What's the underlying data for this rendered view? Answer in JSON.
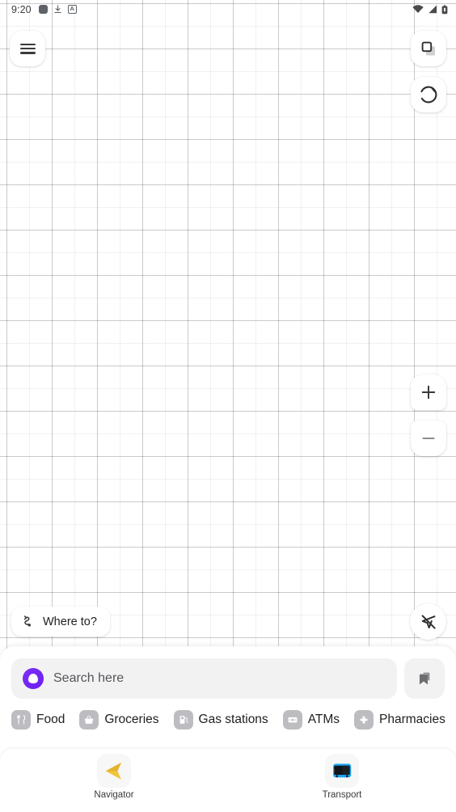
{
  "status_bar": {
    "time": "9:20",
    "left_icons": [
      "rounded-square-icon",
      "download-icon",
      "a-badge-icon"
    ],
    "right_icons": [
      "wifi-icon",
      "cellular-signal-icon",
      "battery-icon"
    ]
  },
  "map": {
    "state": "loading-grid-placeholder",
    "background_color": "#ffffff",
    "grid_color": "#e6e6e6"
  },
  "map_controls": {
    "menu_label": "Menu",
    "layers_label": "Map layers",
    "compass_label": "Compass",
    "zoom_in_label": "+",
    "zoom_out_label": "−",
    "location_label": "Location off"
  },
  "where_to": {
    "label": "Where to?",
    "icon": "route-icon"
  },
  "search": {
    "placeholder": "Search here",
    "assistant_icon": "alice-logo-icon",
    "assistant_color": "#7b2ff7",
    "bookmarks_icon": "bookmarks-icon"
  },
  "categories": [
    {
      "label": "Food",
      "icon": "cutlery-icon"
    },
    {
      "label": "Groceries",
      "icon": "basket-icon"
    },
    {
      "label": "Gas stations",
      "icon": "fuel-pump-icon"
    },
    {
      "label": "ATMs",
      "icon": "banknote-icon"
    },
    {
      "label": "Pharmacies",
      "icon": "cross-icon"
    }
  ],
  "bottom_nav": [
    {
      "label": "Navigator",
      "icon": "navigator-arrow-icon",
      "color": "#f2c33c"
    },
    {
      "label": "Transport",
      "icon": "bus-icon",
      "color": "#1ea4f0"
    }
  ]
}
